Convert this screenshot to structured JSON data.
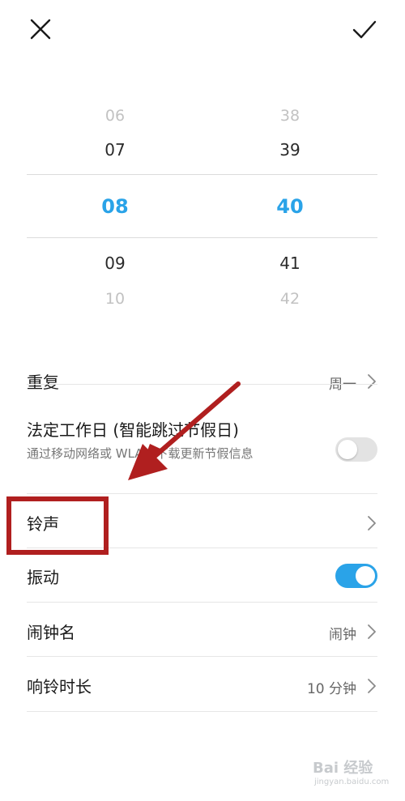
{
  "picker": {
    "hours": [
      "06",
      "07",
      "08",
      "09",
      "10"
    ],
    "minutes": [
      "38",
      "39",
      "40",
      "41",
      "42"
    ]
  },
  "settings": {
    "repeat": {
      "label": "重复",
      "value": "周一"
    },
    "workday": {
      "label": "法定工作日 (智能跳过节假日)",
      "subtitle": "通过移动网络或 WLAN 下载更新节假信息",
      "enabled": false
    },
    "ringtone": {
      "label": "铃声"
    },
    "vibrate": {
      "label": "振动",
      "enabled": true
    },
    "alarm_name": {
      "label": "闹钟名",
      "value": "闹钟"
    },
    "ring_duration": {
      "label": "响铃时长",
      "value": "10 分钟"
    }
  },
  "colors": {
    "accent": "#2aa3e8",
    "annotation": "#b01f1f"
  },
  "icons": {
    "close": "close-icon",
    "confirm": "check-icon",
    "chevron": "chevron-right-icon"
  },
  "watermark": {
    "main": "Bai 经验",
    "sub": "jingyan.baidu.com"
  }
}
